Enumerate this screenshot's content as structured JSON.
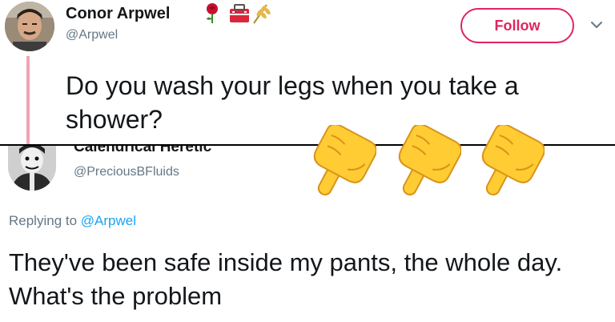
{
  "original_tweet": {
    "display_name": "Conor Arpwel",
    "name_emojis": [
      "rose-icon",
      "toolbox-icon",
      "wheat-icon"
    ],
    "handle": "@Arpwel",
    "follow_label": "Follow",
    "text": "Do you wash your legs when you take a shower?"
  },
  "reply_tweet": {
    "display_name": "Calendrical Heretic",
    "handle": "@PreciousBFluids",
    "replying_prefix": "Replying to",
    "replying_handle": "@Arpwel",
    "text": "They've been safe inside my pants, the whole day. What's the problem"
  },
  "overlay": {
    "icons": [
      "pointing-down-hand-icon",
      "pointing-down-hand-icon",
      "pointing-down-hand-icon"
    ]
  },
  "colors": {
    "follow_accent": "#e0245e",
    "thread_line": "#f2a3b3",
    "link_blue": "#1da1f2",
    "secondary_text": "#657786",
    "primary_text": "#14171a"
  }
}
